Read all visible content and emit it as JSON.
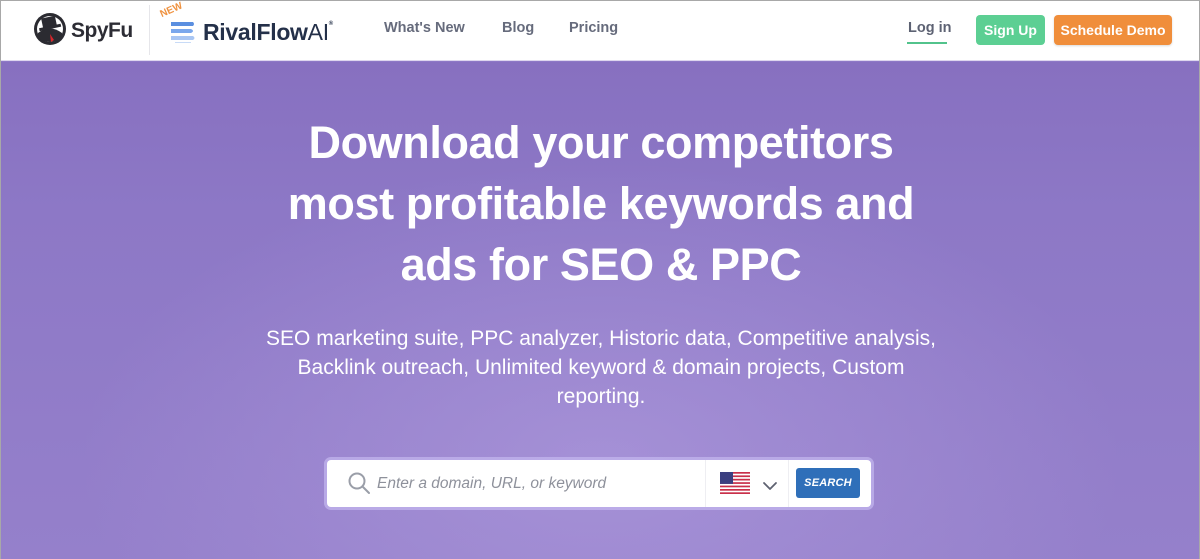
{
  "navbar": {
    "brand_spyfu": "SpyFu",
    "brand_rival_badge": "NEW",
    "brand_rival_name": "RivalFlow",
    "brand_rival_suffix": "AI",
    "brand_rival_mark": "®",
    "links": [
      {
        "label": "What's New"
      },
      {
        "label": "Blog"
      },
      {
        "label": "Pricing"
      }
    ],
    "login_label": "Log in",
    "signup_label": "Sign Up",
    "demo_label": "Schedule Demo"
  },
  "hero": {
    "title_lines": [
      "Download your competitors",
      "most profitable keywords and",
      "ads for SEO & PPC"
    ],
    "subtitle_lines": [
      "SEO marketing suite, PPC analyzer, Historic data, Competitive analysis,",
      "Backlink outreach, Unlimited keyword & domain projects, Custom",
      "reporting."
    ]
  },
  "search": {
    "placeholder": "Enter a domain, URL, or keyword",
    "value": "",
    "country": "US",
    "country_icon": "us-flag-icon",
    "button_label": "SEARCH"
  },
  "colors": {
    "hero_bg": "#8d78c6",
    "signup": "#5ccf93",
    "demo": "#f08e3b",
    "search_button": "#2f6fb9",
    "login_underline": "#52c38c",
    "new_badge": "#ef9240"
  }
}
